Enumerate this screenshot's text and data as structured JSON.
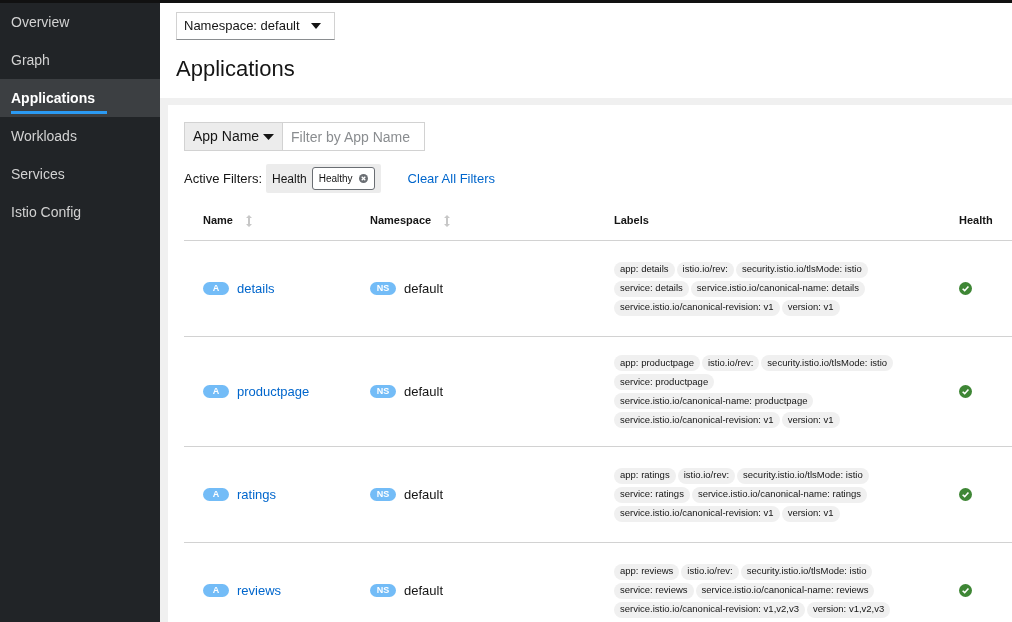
{
  "sidebar": {
    "items": [
      {
        "label": "Overview",
        "selected": false
      },
      {
        "label": "Graph",
        "selected": false
      },
      {
        "label": "Applications",
        "selected": true
      },
      {
        "label": "Workloads",
        "selected": false
      },
      {
        "label": "Services",
        "selected": false
      },
      {
        "label": "Istio Config",
        "selected": false
      }
    ]
  },
  "namespace_selector": {
    "value": "Namespace: default"
  },
  "title": "Applications",
  "filter": {
    "type": "App Name",
    "placeholder": "Filter by App Name"
  },
  "active_filters": {
    "label": "Active Filters:",
    "groups": [
      {
        "category": "Health",
        "chips": [
          "Healthy"
        ]
      }
    ],
    "clear": "Clear All Filters"
  },
  "table": {
    "columns": [
      {
        "label": "Name",
        "sortable": true
      },
      {
        "label": "Namespace",
        "sortable": true
      },
      {
        "label": "Labels",
        "sortable": false
      },
      {
        "label": "Health",
        "sortable": false
      }
    ],
    "rows": [
      {
        "badge": "A",
        "name": "details",
        "ns_badge": "NS",
        "namespace": "default",
        "labels": [
          "app: details",
          "istio.io/rev:",
          "security.istio.io/tlsMode: istio",
          "service: details",
          "service.istio.io/canonical-name: details",
          "service.istio.io/canonical-revision: v1",
          "version: v1"
        ],
        "healthy": true
      },
      {
        "badge": "A",
        "name": "productpage",
        "ns_badge": "NS",
        "namespace": "default",
        "labels": [
          "app: productpage",
          "istio.io/rev:",
          "security.istio.io/tlsMode: istio",
          "service: productpage",
          "service.istio.io/canonical-name: productpage",
          "service.istio.io/canonical-revision: v1",
          "version: v1"
        ],
        "healthy": true
      },
      {
        "badge": "A",
        "name": "ratings",
        "ns_badge": "NS",
        "namespace": "default",
        "labels": [
          "app: ratings",
          "istio.io/rev:",
          "security.istio.io/tlsMode: istio",
          "service: ratings",
          "service.istio.io/canonical-name: ratings",
          "service.istio.io/canonical-revision: v1",
          "version: v1"
        ],
        "healthy": true
      },
      {
        "badge": "A",
        "name": "reviews",
        "ns_badge": "NS",
        "namespace": "default",
        "labels": [
          "app: reviews",
          "istio.io/rev:",
          "security.istio.io/tlsMode: istio",
          "service: reviews",
          "service.istio.io/canonical-name: reviews",
          "service.istio.io/canonical-revision: v1,v2,v3",
          "version: v1,v2,v3"
        ],
        "healthy": true
      }
    ]
  }
}
